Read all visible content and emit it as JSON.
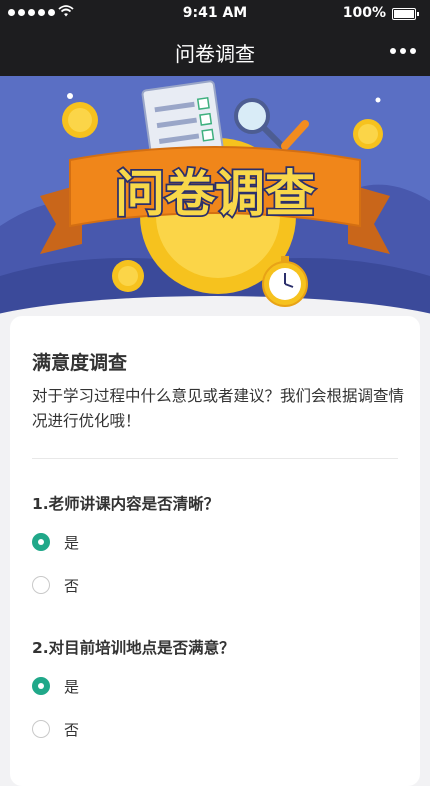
{
  "status": {
    "time": "9:41 AM",
    "battery": "100%"
  },
  "nav": {
    "title": "问卷调查"
  },
  "banner": {
    "text": "问卷调查"
  },
  "survey": {
    "title": "满意度调查",
    "description": "对于学习过程中什么意见或者建议？我们会根据调查情况进行优化哦！",
    "questions": [
      {
        "text": "1.老师讲课内容是否清晰？",
        "options": [
          {
            "label": "是",
            "checked": true
          },
          {
            "label": "否",
            "checked": false
          }
        ]
      },
      {
        "text": "2.对目前培训地点是否满意？",
        "options": [
          {
            "label": "是",
            "checked": true
          },
          {
            "label": "否",
            "checked": false
          }
        ]
      }
    ]
  },
  "colors": {
    "accent": "#20a889",
    "nav_bg": "#1d1d1f",
    "banner_bg": "#5a6fc4",
    "banner_ribbon": "#f0861a"
  }
}
